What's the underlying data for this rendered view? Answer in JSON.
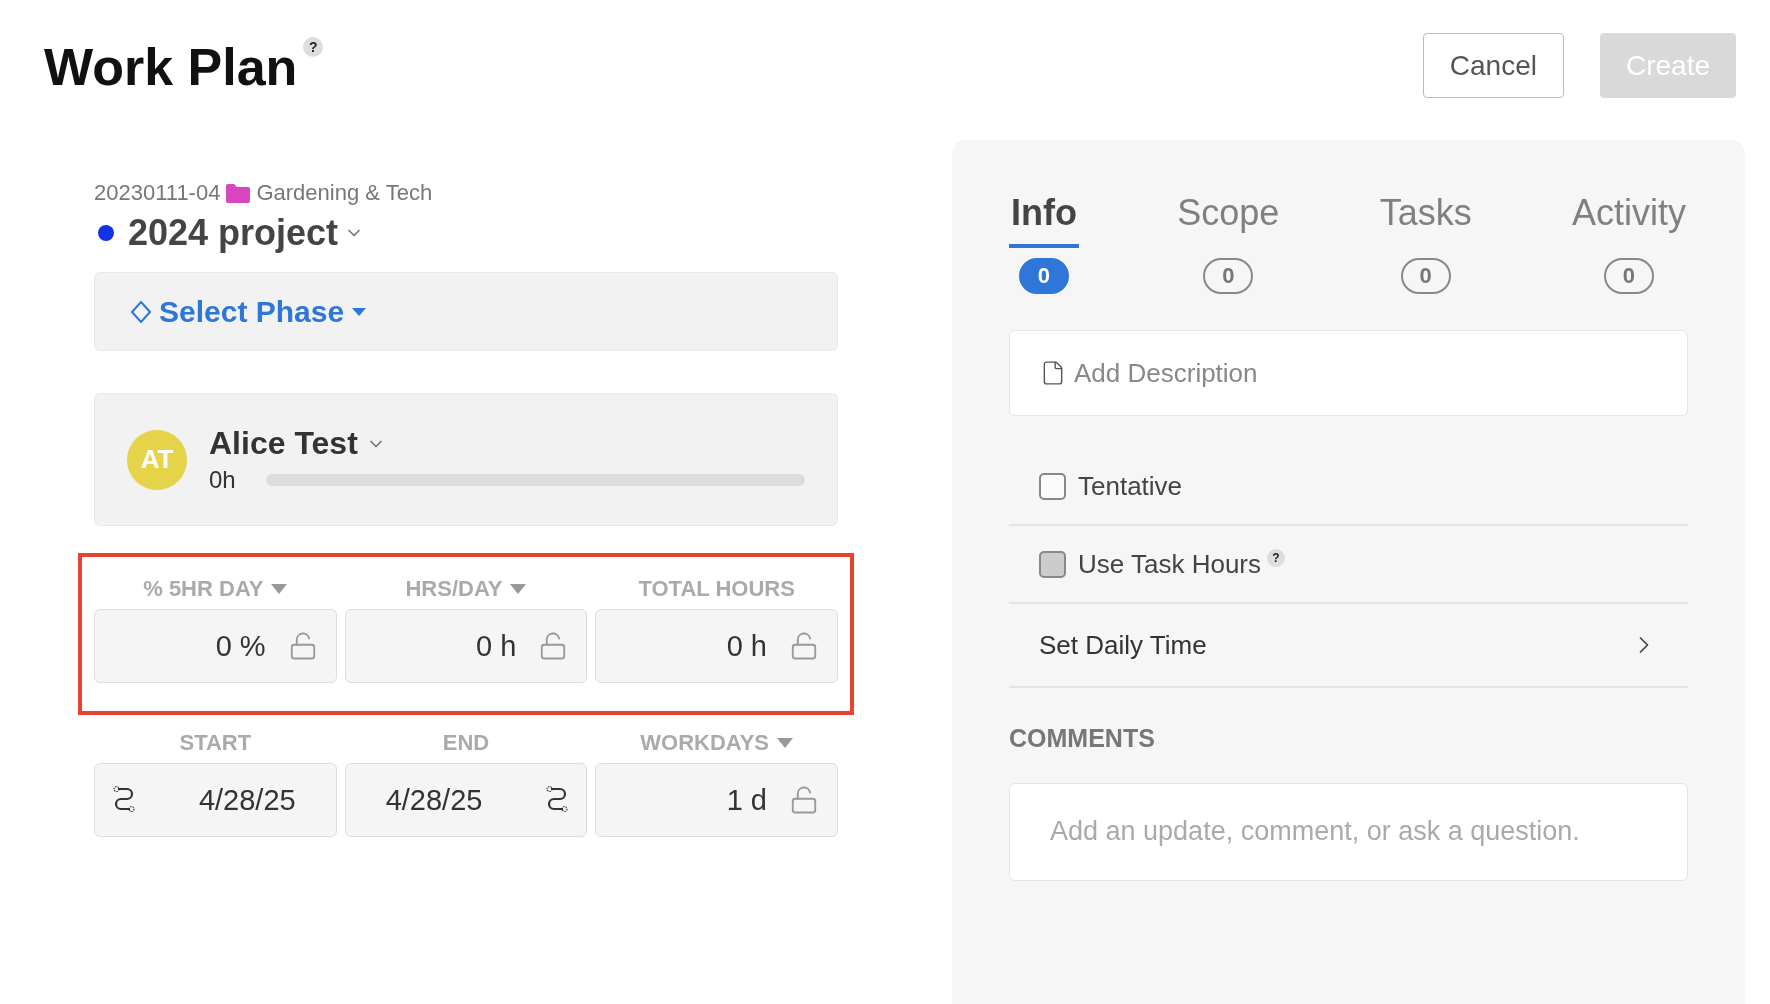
{
  "header": {
    "title": "Work Plan",
    "help": "?",
    "buttons": [
      {
        "label": "Cancel",
        "kind": "secondary",
        "disabled": false
      },
      {
        "label": "Create",
        "kind": "primary",
        "disabled": true
      }
    ]
  },
  "project": {
    "code": "20230111-04",
    "portfolio": "Gardening & Tech",
    "name": "2024 project",
    "color": "#1432e6"
  },
  "phase": {
    "label": "Select Phase"
  },
  "member": {
    "initials": "AT",
    "color": "#e5d44a",
    "name": "Alice Test",
    "hours": "0h",
    "level": 0
  },
  "allocation": {
    "highlighted": true,
    "fields": [
      {
        "label": "% 5HR DAY",
        "dropdown": true,
        "value": "0 %",
        "kind": "lock"
      },
      {
        "label": "HRS/DAY",
        "dropdown": true,
        "value": "0 h",
        "kind": "lock"
      },
      {
        "label": "TOTAL HOURS",
        "dropdown": false,
        "value": "0 h",
        "kind": "lock"
      }
    ]
  },
  "dates": {
    "fields": [
      {
        "label": "START",
        "dropdown": false,
        "value": "4/28/25",
        "kind": "link_left"
      },
      {
        "label": "END",
        "dropdown": false,
        "value": "4/28/25",
        "kind": "link_right"
      },
      {
        "label": "WORKDAYS",
        "dropdown": true,
        "value": "1 d",
        "kind": "lock"
      }
    ]
  },
  "tabs": [
    {
      "label": "Info",
      "count": "0",
      "selected": true
    },
    {
      "label": "Scope",
      "count": "0",
      "selected": false
    },
    {
      "label": "Tasks",
      "count": "0",
      "selected": false
    },
    {
      "label": "Activity",
      "count": "0",
      "selected": false
    }
  ],
  "description": {
    "placeholder": "Add Description"
  },
  "options": [
    {
      "label": "Tentative",
      "checked": false,
      "disabled": false
    },
    {
      "label": "Use Task Hours",
      "checked": false,
      "disabled": true,
      "help": "?"
    }
  ],
  "daily_time": {
    "label": "Set Daily Time"
  },
  "comments": {
    "heading": "COMMENTS",
    "placeholder": "Add an update, comment, or ask a question."
  }
}
